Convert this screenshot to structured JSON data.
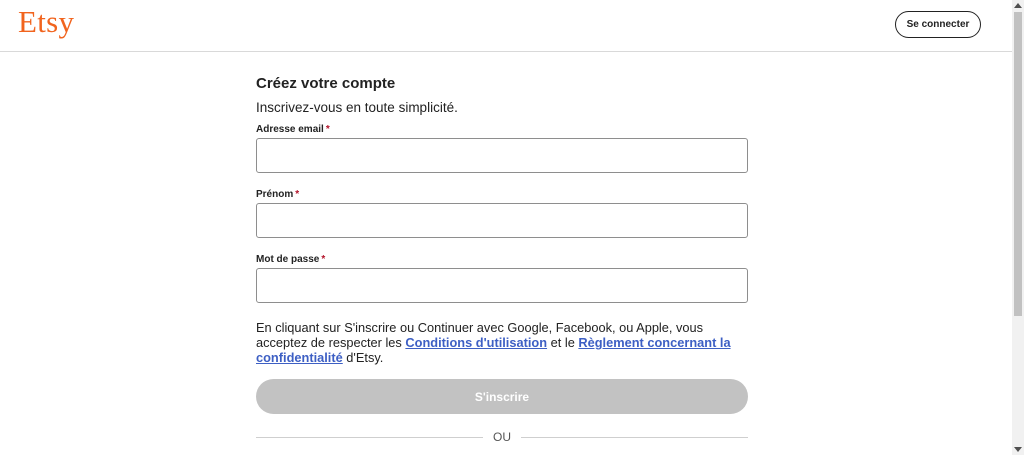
{
  "header": {
    "logo_text": "Etsy",
    "signin_label": "Se connecter"
  },
  "form": {
    "title": "Créez votre compte",
    "subtitle": "Inscrivez-vous en toute simplicité.",
    "fields": [
      {
        "label": "Adresse email",
        "required_mark": "*",
        "value": ""
      },
      {
        "label": "Prénom",
        "required_mark": "*",
        "value": ""
      },
      {
        "label": "Mot de passe",
        "required_mark": "*",
        "value": ""
      }
    ],
    "legal": {
      "text_before": "En cliquant sur S'inscrire ou Continuer avec Google, Facebook, ou Apple, vous acceptez de respecter les ",
      "terms_link": "Conditions d'utilisation",
      "text_middle": " et le ",
      "privacy_link": "Règlement concernant la confidentialité",
      "text_after": " d'Etsy."
    },
    "submit_label": "S'inscrire",
    "divider_text": "OU"
  },
  "icons": {
    "scroll_up": "chevron-up-icon",
    "scroll_down": "chevron-down-icon"
  },
  "colors": {
    "brand": "#F1641E",
    "link": "#3d5fc4",
    "required": "#b3132a",
    "button_disabled": "#c2c2c2"
  }
}
